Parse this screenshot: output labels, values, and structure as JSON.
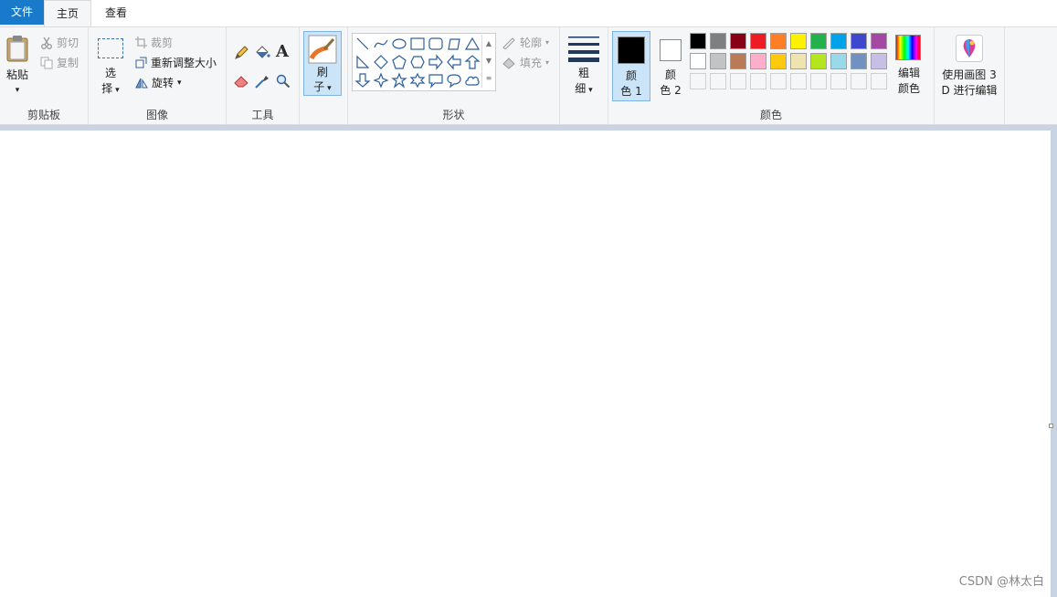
{
  "tabs": [
    "文件",
    "主页",
    "查看"
  ],
  "clipboard": {
    "paste_line1": "粘贴",
    "cut": "剪切",
    "copy": "复制",
    "group": "剪贴板"
  },
  "image": {
    "select_line1": "选",
    "select_line2": "择",
    "crop": "裁剪",
    "resize": "重新调整大小",
    "rotate": "旋转",
    "group": "图像"
  },
  "tools": {
    "group": "工具"
  },
  "brush": {
    "line1": "刷",
    "line2": "子"
  },
  "shapes": {
    "outline": "轮廓",
    "fill": "填充",
    "group": "形状"
  },
  "size": {
    "line1": "粗",
    "line2": "细"
  },
  "colors": {
    "color1_line1": "颜",
    "color1_line2": "色 1",
    "color2_line1": "颜",
    "color2_line2": "色 2",
    "edit_line1": "编辑",
    "edit_line2": "颜色",
    "group": "颜色",
    "color1": "#000000",
    "color2": "#ffffff",
    "palette_row1": [
      "#000000",
      "#7f7f7f",
      "#880015",
      "#ed1c24",
      "#ff7f27",
      "#fff200",
      "#22b14c",
      "#00a2e8",
      "#3f48cc",
      "#a349a4"
    ],
    "palette_row2": [
      "#ffffff",
      "#c3c3c3",
      "#b97a57",
      "#ffaec9",
      "#ffc90e",
      "#efe4b0",
      "#b5e61d",
      "#99d9ea",
      "#7092be",
      "#c8bfe7"
    ]
  },
  "paint3d": {
    "line1": "使用画图 3",
    "line2": "D 进行编辑"
  },
  "watermark": "CSDN @林太白"
}
